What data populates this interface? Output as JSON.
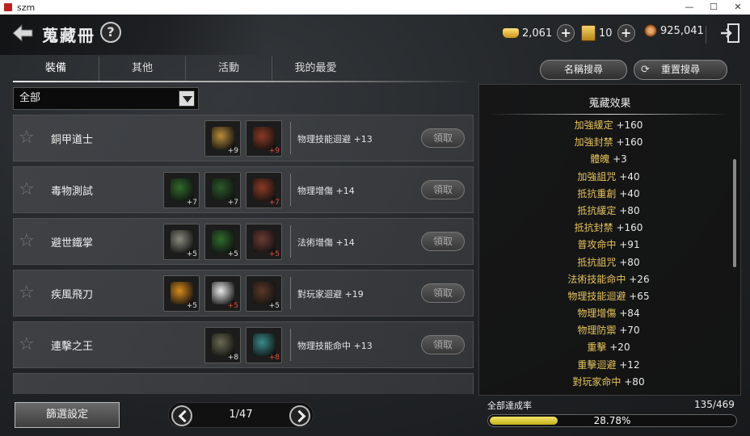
{
  "window": {
    "title": "szm",
    "minimize": "—",
    "maximize": "☐",
    "close": "✕"
  },
  "header": {
    "title": "蒐藏冊",
    "help": "?",
    "currencies": [
      {
        "icon": "gold-ingot-icon",
        "value": "2,061"
      },
      {
        "icon": "scroll-ticket-icon",
        "value": "10"
      },
      {
        "icon": "coin-icon",
        "value": "925,041"
      }
    ]
  },
  "tabs": [
    "裝備",
    "其他",
    "活動",
    "我的最愛"
  ],
  "buttons": {
    "name_search": "名稱搜尋",
    "reset_search": "重置搜尋",
    "filter_settings": "篩選設定",
    "claim": "領取"
  },
  "filter": {
    "selected": "全部"
  },
  "rows": [
    {
      "name": "銅甲道士",
      "bonus": "物理技能迴避 +13",
      "items": [
        {
          "icon": "golden-helmet-icon",
          "count": "+9",
          "color": "#b98c3a",
          "count_color": "#dddddd"
        },
        {
          "icon": "leather-armor-icon",
          "count": "+9",
          "color": "#8c3a24",
          "count_color": "#e14b3b"
        }
      ]
    },
    {
      "name": "毒物測試",
      "bonus": "物理增傷 +14",
      "items": [
        {
          "icon": "green-poison-skill-icon",
          "count": "+7",
          "color": "#2f6a2b",
          "count_color": "#dddddd"
        },
        {
          "icon": "green-strike-skill-icon",
          "count": "+7",
          "color": "#2b5a2a",
          "count_color": "#dddddd"
        },
        {
          "icon": "leather-armor-icon",
          "count": "+7",
          "color": "#8c3a24",
          "count_color": "#e14b3b"
        }
      ]
    },
    {
      "name": "避世鐵掌",
      "bonus": "法術增傷 +14",
      "items": [
        {
          "icon": "stone-fist-icon",
          "count": "+5",
          "color": "#8a8a80",
          "count_color": "#dddddd"
        },
        {
          "icon": "green-orb-skill-icon",
          "count": "+5",
          "color": "#2f6a2b",
          "count_color": "#dddddd"
        },
        {
          "icon": "gauntlet-icon",
          "count": "+5",
          "color": "#6b3a30",
          "count_color": "#e14b3b"
        }
      ]
    },
    {
      "name": "疾風飛刀",
      "bonus": "對玩家迴避 +19",
      "items": [
        {
          "icon": "flying-blade-icon",
          "count": "+5",
          "color": "#d98a1c",
          "count_color": "#dddddd"
        },
        {
          "icon": "running-figure-icon",
          "count": "+5",
          "color": "#e8e8e8",
          "count_color": "#e14b3b"
        },
        {
          "icon": "robe-icon",
          "count": "+5",
          "color": "#5a3828",
          "count_color": "#dddddd"
        }
      ]
    },
    {
      "name": "連擊之王",
      "bonus": "物理技能命中 +13",
      "items": [
        {
          "icon": "dagger-icon",
          "count": "+8",
          "color": "#6a6a52",
          "count_color": "#dddddd"
        },
        {
          "icon": "teal-combo-skill-icon",
          "count": "+8",
          "color": "#3a8a8a",
          "count_color": "#e14b3b"
        }
      ]
    }
  ],
  "pager": {
    "label": "1/47"
  },
  "effects": {
    "title": "蒐藏效果",
    "items": [
      {
        "name": "加強緩定",
        "value": "+160"
      },
      {
        "name": "加強封禁",
        "value": "+160"
      },
      {
        "name": "體魄",
        "value": "+3"
      },
      {
        "name": "加強詛咒",
        "value": "+40"
      },
      {
        "name": "抵抗重創",
        "value": "+40"
      },
      {
        "name": "抵抗緩定",
        "value": "+80"
      },
      {
        "name": "抵抗封禁",
        "value": "+160"
      },
      {
        "name": "普攻命中",
        "value": "+91"
      },
      {
        "name": "抵抗詛咒",
        "value": "+80"
      },
      {
        "name": "法術技能命中",
        "value": "+26"
      },
      {
        "name": "物理技能迴避",
        "value": "+65"
      },
      {
        "name": "物理增傷",
        "value": "+84"
      },
      {
        "name": "物理防禦",
        "value": "+70"
      },
      {
        "name": "重擊",
        "value": "+20"
      },
      {
        "name": "重擊迴避",
        "value": "+12"
      },
      {
        "name": "對玩家命中",
        "value": "+80"
      }
    ]
  },
  "progress": {
    "label": "全部達成率",
    "count": "135/469",
    "percent": "28.78%",
    "fraction": 0.2878
  }
}
